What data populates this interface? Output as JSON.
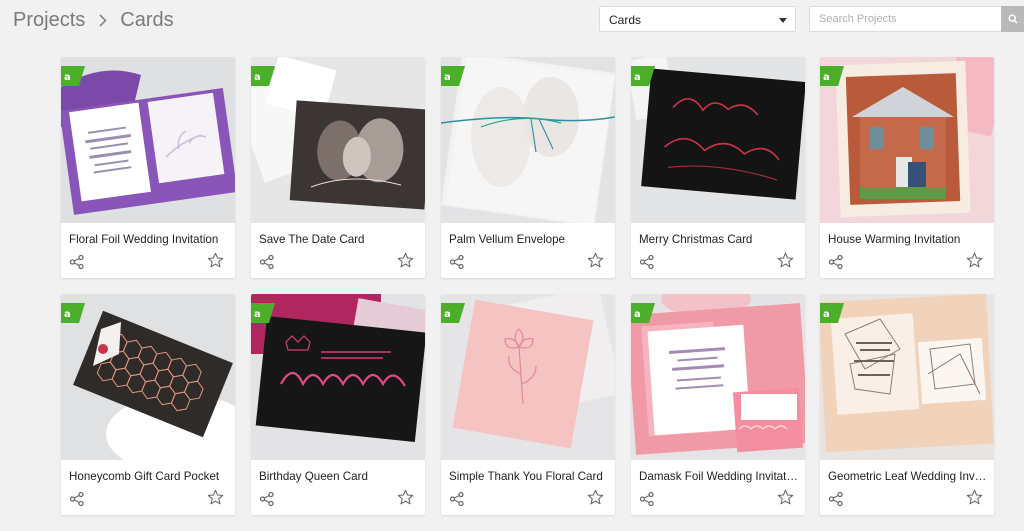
{
  "breadcrumb": {
    "root": "Projects",
    "current": "Cards"
  },
  "filter": {
    "selected": "Cards"
  },
  "search": {
    "placeholder": "Search Projects"
  },
  "colors": {
    "badge_green": "#4caf2a",
    "icon_gray": "#6b6b6b"
  },
  "cards": [
    {
      "title": "Floral Foil Wedding Invitation",
      "theme": "purple"
    },
    {
      "title": "Save The Date Card",
      "theme": "photo-bw"
    },
    {
      "title": "Palm Vellum Envelope",
      "theme": "vellum"
    },
    {
      "title": "Merry Christmas Card",
      "theme": "black-red"
    },
    {
      "title": "House Warming Invitation",
      "theme": "house-photo"
    },
    {
      "title": "Honeycomb Gift Card Pocket",
      "theme": "honeycomb"
    },
    {
      "title": "Birthday Queen Card",
      "theme": "pink-black"
    },
    {
      "title": "Simple Thank You Floral Card",
      "theme": "pink"
    },
    {
      "title": "Damask Foil Wedding Invitat…",
      "theme": "damask"
    },
    {
      "title": "Geometric Leaf Wedding Inv…",
      "theme": "peach"
    }
  ]
}
